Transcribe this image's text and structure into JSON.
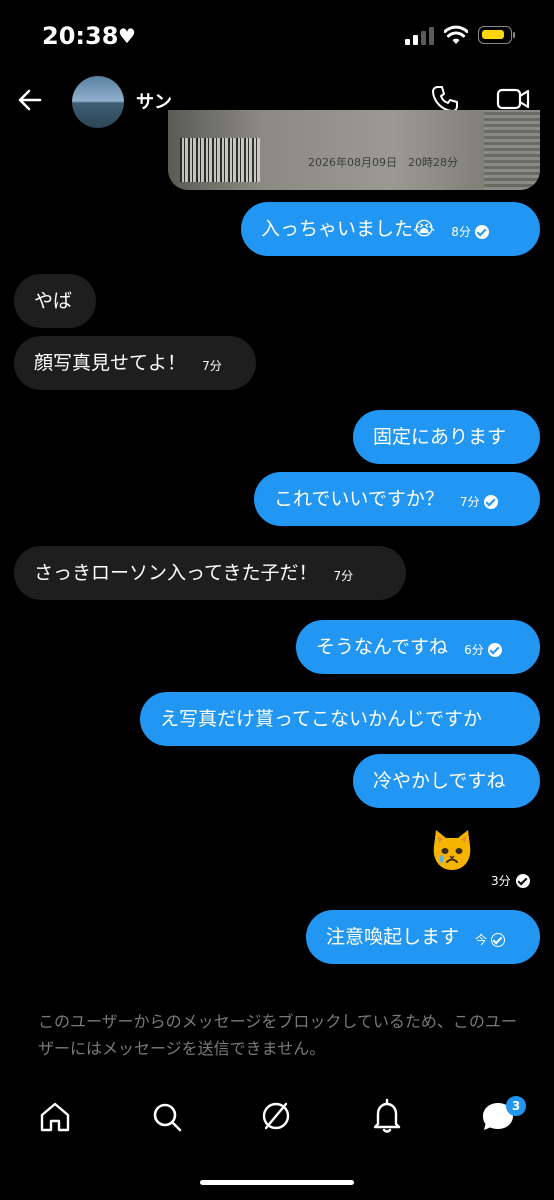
{
  "status_bar": {
    "time": "20:38"
  },
  "header": {
    "contact_name": "サン"
  },
  "photo": {
    "date_stamp": "2026年08月09日　20時28分"
  },
  "messages": [
    {
      "side": "out",
      "text": "入っちゃいました😭",
      "time": "8分",
      "read": true
    },
    {
      "side": "in",
      "text": "やば",
      "time": ""
    },
    {
      "side": "in",
      "text": "顔写真見せてよ！",
      "time": "7分"
    },
    {
      "side": "out",
      "text": "固定にあります",
      "time": ""
    },
    {
      "side": "out",
      "text": "これでいいですか？",
      "time": "7分",
      "read": true
    },
    {
      "side": "in",
      "text": "さっきローソン入ってきた子だ！",
      "time": "7分"
    },
    {
      "side": "out",
      "text": "そうなんですね",
      "time": "6分",
      "read": true
    },
    {
      "side": "out",
      "text": "え写真だけ貰ってこないかんじですか",
      "time": ""
    },
    {
      "side": "out",
      "text": "冷やかしですね",
      "time": ""
    },
    {
      "side": "out",
      "text": "😿",
      "time": "3分",
      "read": true,
      "type": "emoji"
    },
    {
      "side": "out",
      "text": "注意喚起します",
      "time": "今",
      "read": false
    }
  ],
  "blocked_notice": "このユーザーからのメッセージをブロックしているため、このユーザーにはメッセージを送信できません。",
  "nav": {
    "dm_badge": "3"
  },
  "colors": {
    "accent": "#2196f3",
    "incoming_bubble": "#1e1e1e",
    "background": "#000000"
  }
}
